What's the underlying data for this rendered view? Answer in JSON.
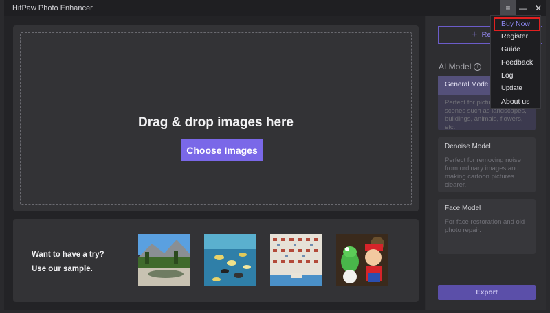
{
  "window": {
    "title": "HitPaw Photo Enhancer"
  },
  "drop_area": {
    "headline": "Drag & drop images here",
    "choose_button": "Choose Images"
  },
  "samples": {
    "line1": "Want to have a try?",
    "line2": "Use our sample."
  },
  "sidebar": {
    "replace_button": "Replace",
    "ai_model_label": "AI Model",
    "models": [
      {
        "title": "General Model",
        "desc": "Perfect for pictures of scenes such as landscapes, buildings, animals, flowers, etc."
      },
      {
        "title": "Denoise Model",
        "desc": "Perfect for removing noise from ordinary images and making cartoon pictures clearer."
      },
      {
        "title": "Face Model",
        "desc": "For face restoration and old photo repair."
      }
    ],
    "export_button": "Export"
  },
  "menu": {
    "items": [
      "Buy Now",
      "Register",
      "Guide",
      "Feedback",
      "Log",
      "Update",
      "About us"
    ],
    "highlighted": "Buy Now"
  },
  "colors": {
    "accent": "#7a68e8",
    "highlight_border": "#e02020"
  }
}
